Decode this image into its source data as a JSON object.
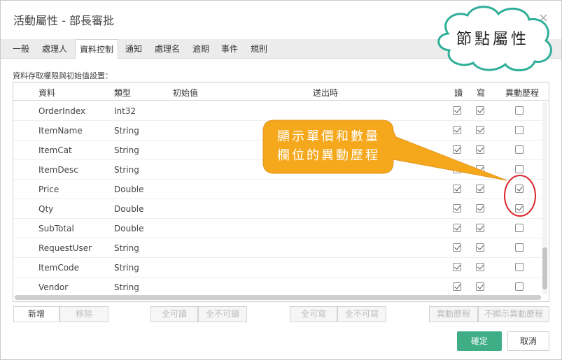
{
  "window": {
    "title": "活動屬性 - 部長審批",
    "close_glyph": "×"
  },
  "tabs": [
    "一般",
    "處理人",
    "資料控制",
    "通知",
    "處理名",
    "逾期",
    "事件",
    "規則"
  ],
  "active_tab": "資料控制",
  "section_label": "資料存取權限與初始值設置：",
  "table": {
    "columns": {
      "data": "資料",
      "type": "類型",
      "initial": "初始值",
      "on_send": "送出時",
      "read": "讀",
      "write": "寫",
      "history": "異動歷程"
    },
    "rows": [
      {
        "name": "OrderIndex",
        "type": "Int32",
        "read": true,
        "write": true,
        "history": false
      },
      {
        "name": "ItemName",
        "type": "String",
        "read": true,
        "write": true,
        "history": false
      },
      {
        "name": "ItemCat",
        "type": "String",
        "read": true,
        "write": true,
        "history": false
      },
      {
        "name": "ItemDesc",
        "type": "String",
        "read": true,
        "write": true,
        "history": false
      },
      {
        "name": "Price",
        "type": "Double",
        "read": true,
        "write": true,
        "history": true
      },
      {
        "name": "Qty",
        "type": "Double",
        "read": true,
        "write": true,
        "history": true
      },
      {
        "name": "SubTotal",
        "type": "Double",
        "read": true,
        "write": true,
        "history": false
      },
      {
        "name": "RequestUser",
        "type": "String",
        "read": true,
        "write": true,
        "history": false
      },
      {
        "name": "ItemCode",
        "type": "String",
        "read": true,
        "write": true,
        "history": false
      },
      {
        "name": "Vendor",
        "type": "String",
        "read": true,
        "write": true,
        "history": false
      }
    ]
  },
  "buttons": {
    "add": "新增",
    "remove": "移除",
    "all_read": "全可讀",
    "none_read": "全不可讀",
    "all_write": "全可寫",
    "none_write": "全不可寫",
    "history": "異動歷程",
    "no_history": "不顯示異動歷程",
    "ok": "確定",
    "cancel": "取消"
  },
  "annotations": {
    "cloud": "節點屬性",
    "callout_line1": "顯示單價和數量",
    "callout_line2": "欄位的異動歷程"
  },
  "colors": {
    "ok_green": "#3fae87",
    "callout_orange": "#f5a81c",
    "highlight_red": "#d9262b",
    "cloud_teal": "#2fae98"
  }
}
